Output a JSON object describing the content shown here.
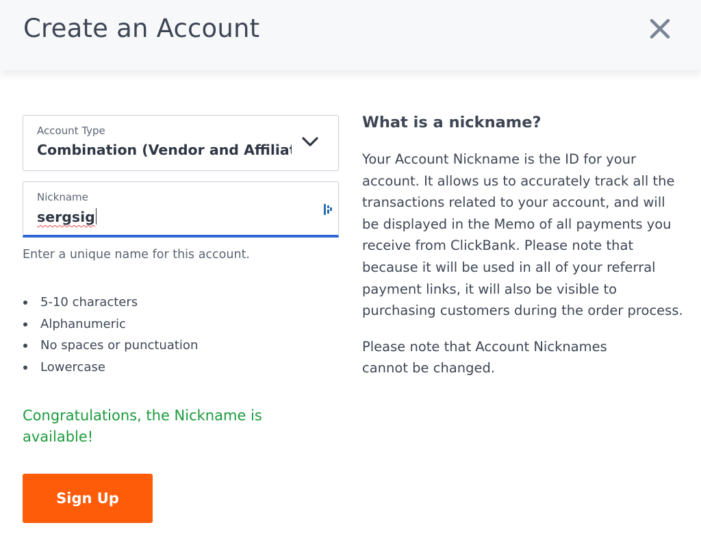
{
  "header": {
    "title": "Create an Account",
    "close_icon": "close-icon"
  },
  "form": {
    "account_type": {
      "label": "Account Type",
      "value": "Combination (Vendor and Affiliate"
    },
    "nickname": {
      "label": "Nickname",
      "value": "sergsig",
      "hint": "Enter a unique name for this account."
    },
    "rules": [
      "5-10 characters",
      "Alphanumeric",
      "No spaces or punctuation",
      "Lowercase"
    ],
    "success_message": "Congratulations, the Nickname is available!",
    "submit_label": "Sign Up"
  },
  "help": {
    "title": "What is a nickname?",
    "paragraph1": "Your Account Nickname is the ID for your account. It allows us to accurately track all the transactions related to your account, and will be displayed in the Memo of all payments you receive from ClickBank. Please note that because it will be used in all of your referral payment links, it will also be visible to purchasing customers during the order process.",
    "paragraph2": "Please note that Account Nicknames cannot be changed."
  },
  "colors": {
    "accent_button": "#ff5c0a",
    "focus_border": "#2f66d4",
    "success_text": "#1c9b3d"
  }
}
